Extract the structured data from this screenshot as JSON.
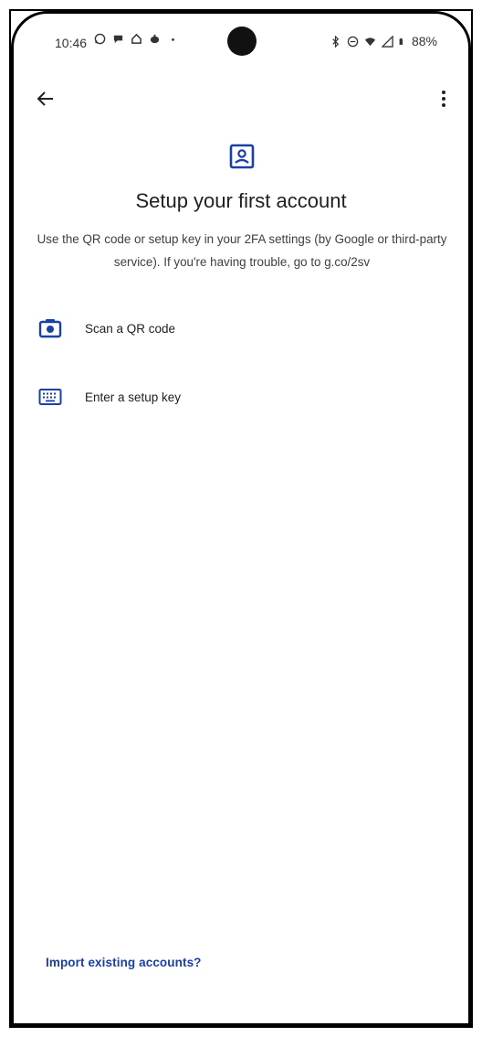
{
  "status_bar": {
    "time": "10:46",
    "battery": "88%",
    "left_icons": [
      "whatsapp-icon",
      "chat-bubble-icon",
      "home-icon",
      "teapot-icon",
      "dot-icon"
    ],
    "right_icons": [
      "bluetooth-icon",
      "do-not-disturb-icon",
      "wifi-icon",
      "signal-icon",
      "battery-icon"
    ]
  },
  "app_bar": {
    "back_icon": "arrow-back-icon",
    "menu_icon": "more-vert-icon"
  },
  "header": {
    "icon": "account-box-icon",
    "title": "Setup your first account",
    "subtitle": "Use the QR code or setup key in your 2FA settings (by Google or third-party service). If you're having trouble, go to g.co/2sv"
  },
  "options": [
    {
      "icon": "camera-icon",
      "label": "Scan a QR code"
    },
    {
      "icon": "keyboard-icon",
      "label": "Enter a setup key"
    }
  ],
  "footer": {
    "import_link": "Import existing accounts?"
  },
  "colors": {
    "accent": "#1a3fa6",
    "text": "#202124",
    "background": "#ffffff"
  }
}
